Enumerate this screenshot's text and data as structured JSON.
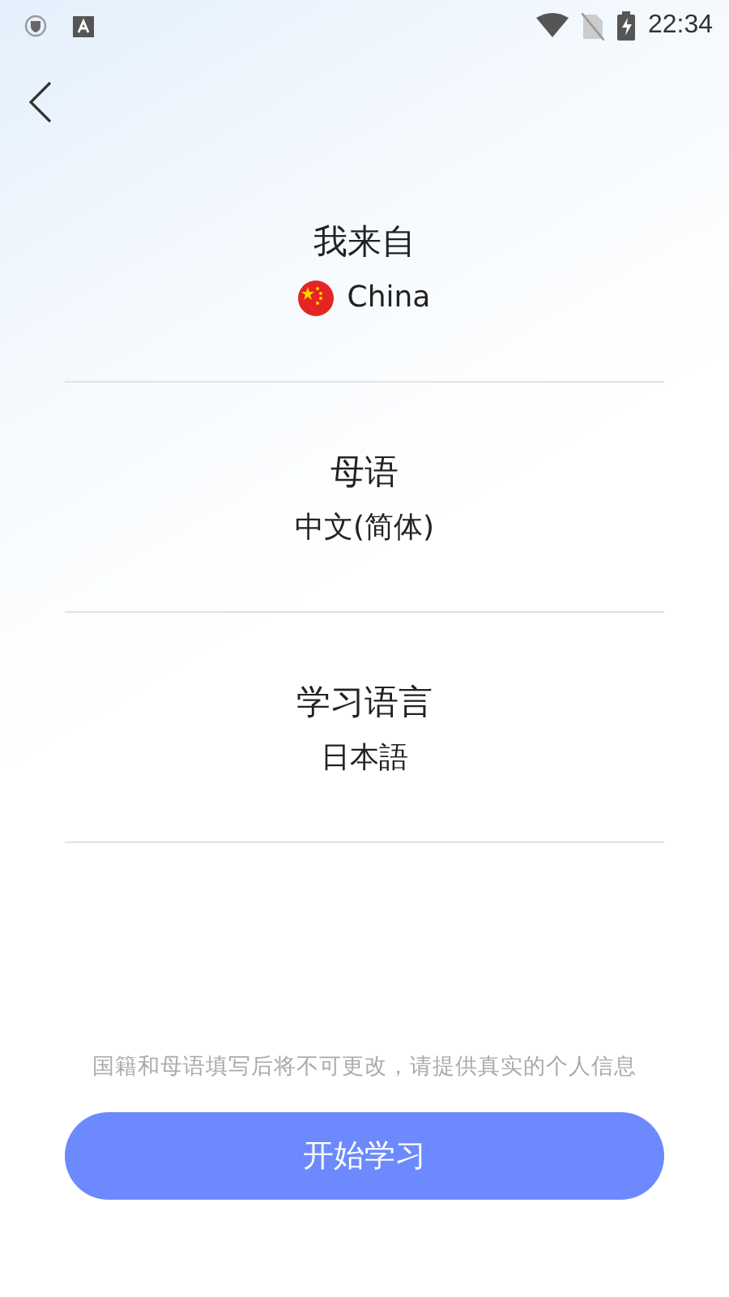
{
  "status_bar": {
    "time": "22:34"
  },
  "sections": [
    {
      "title": "我来自",
      "value": "China",
      "flag": true
    },
    {
      "title": "母语",
      "value": "中文(简体)",
      "flag": false
    },
    {
      "title": "学习语言",
      "value": "日本語",
      "flag": false
    }
  ],
  "notice": "国籍和母语填写后将不可更改，请提供真实的个人信息",
  "start_button": "开始学习"
}
